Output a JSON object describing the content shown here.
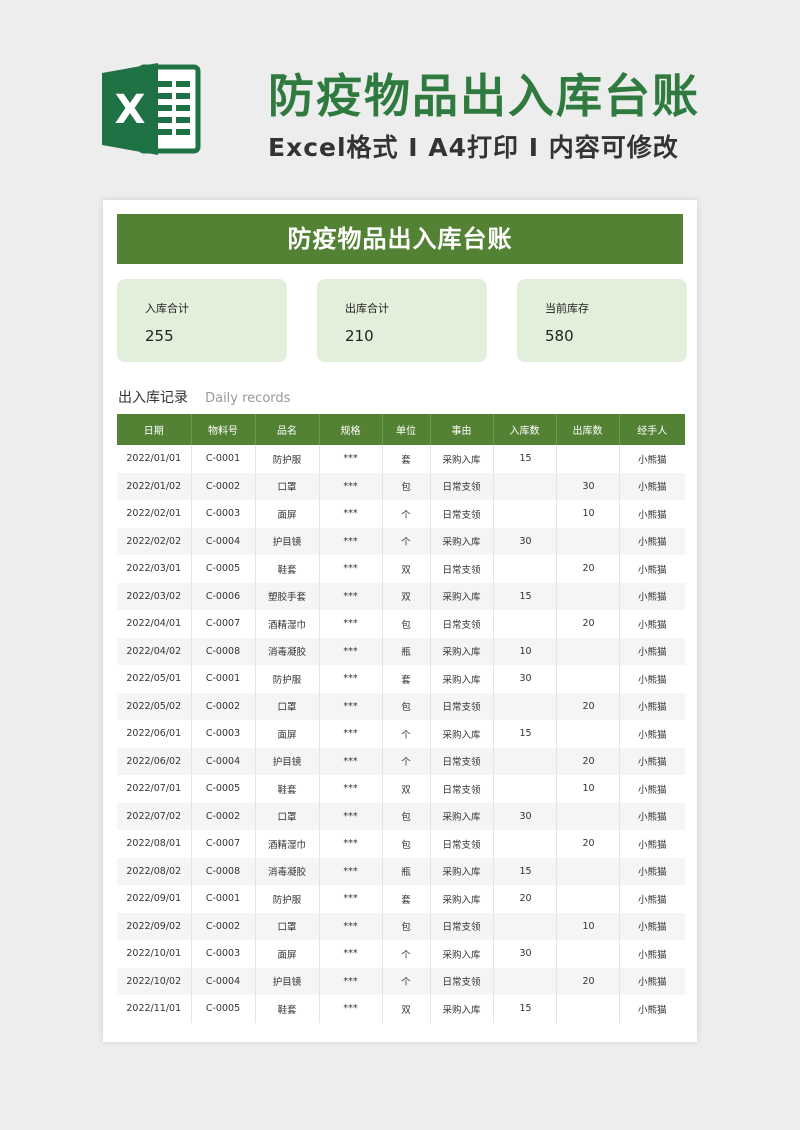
{
  "header": {
    "title": "防疫物品出入库台账",
    "subtitle": "Excel格式 I A4打印 I 内容可修改",
    "logo_letter": "X",
    "logo_color": "#1f7244"
  },
  "sheet": {
    "title": "防疫物品出入库台账",
    "summary": [
      {
        "label": "入库合计",
        "value": "255"
      },
      {
        "label": "出库合计",
        "value": "210"
      },
      {
        "label": "当前库存",
        "value": "580"
      }
    ],
    "records_title": "出入库记录",
    "records_subtitle": "Daily records",
    "columns": [
      "日期",
      "物料号",
      "品名",
      "规格",
      "单位",
      "事由",
      "入库数",
      "出库数",
      "经手人"
    ],
    "rows": [
      [
        "2022/01/01",
        "C-0001",
        "防护服",
        "***",
        "套",
        "采购入库",
        "15",
        "",
        "小熊猫"
      ],
      [
        "2022/01/02",
        "C-0002",
        "口罩",
        "***",
        "包",
        "日常支领",
        "",
        "30",
        "小熊猫"
      ],
      [
        "2022/02/01",
        "C-0003",
        "面屏",
        "***",
        "个",
        "日常支领",
        "",
        "10",
        "小熊猫"
      ],
      [
        "2022/02/02",
        "C-0004",
        "护目镜",
        "***",
        "个",
        "采购入库",
        "30",
        "",
        "小熊猫"
      ],
      [
        "2022/03/01",
        "C-0005",
        "鞋套",
        "***",
        "双",
        "日常支领",
        "",
        "20",
        "小熊猫"
      ],
      [
        "2022/03/02",
        "C-0006",
        "塑胶手套",
        "***",
        "双",
        "采购入库",
        "15",
        "",
        "小熊猫"
      ],
      [
        "2022/04/01",
        "C-0007",
        "酒精湿巾",
        "***",
        "包",
        "日常支领",
        "",
        "20",
        "小熊猫"
      ],
      [
        "2022/04/02",
        "C-0008",
        "消毒凝胶",
        "***",
        "瓶",
        "采购入库",
        "10",
        "",
        "小熊猫"
      ],
      [
        "2022/05/01",
        "C-0001",
        "防护服",
        "***",
        "套",
        "采购入库",
        "30",
        "",
        "小熊猫"
      ],
      [
        "2022/05/02",
        "C-0002",
        "口罩",
        "***",
        "包",
        "日常支领",
        "",
        "20",
        "小熊猫"
      ],
      [
        "2022/06/01",
        "C-0003",
        "面屏",
        "***",
        "个",
        "采购入库",
        "15",
        "",
        "小熊猫"
      ],
      [
        "2022/06/02",
        "C-0004",
        "护目镜",
        "***",
        "个",
        "日常支领",
        "",
        "20",
        "小熊猫"
      ],
      [
        "2022/07/01",
        "C-0005",
        "鞋套",
        "***",
        "双",
        "日常支领",
        "",
        "10",
        "小熊猫"
      ],
      [
        "2022/07/02",
        "C-0002",
        "口罩",
        "***",
        "包",
        "采购入库",
        "30",
        "",
        "小熊猫"
      ],
      [
        "2022/08/01",
        "C-0007",
        "酒精湿巾",
        "***",
        "包",
        "日常支领",
        "",
        "20",
        "小熊猫"
      ],
      [
        "2022/08/02",
        "C-0008",
        "消毒凝胶",
        "***",
        "瓶",
        "采购入库",
        "15",
        "",
        "小熊猫"
      ],
      [
        "2022/09/01",
        "C-0001",
        "防护服",
        "***",
        "套",
        "采购入库",
        "20",
        "",
        "小熊猫"
      ],
      [
        "2022/09/02",
        "C-0002",
        "口罩",
        "***",
        "包",
        "日常支领",
        "",
        "10",
        "小熊猫"
      ],
      [
        "2022/10/01",
        "C-0003",
        "面屏",
        "***",
        "个",
        "采购入库",
        "30",
        "",
        "小熊猫"
      ],
      [
        "2022/10/02",
        "C-0004",
        "护目镜",
        "***",
        "个",
        "日常支领",
        "",
        "20",
        "小熊猫"
      ],
      [
        "2022/11/01",
        "C-0005",
        "鞋套",
        "***",
        "双",
        "采购入库",
        "15",
        "",
        "小熊猫"
      ]
    ]
  },
  "colors": {
    "accent_green": "#548235",
    "title_green": "#2f7a3f",
    "summary_bg": "#e2efda"
  }
}
